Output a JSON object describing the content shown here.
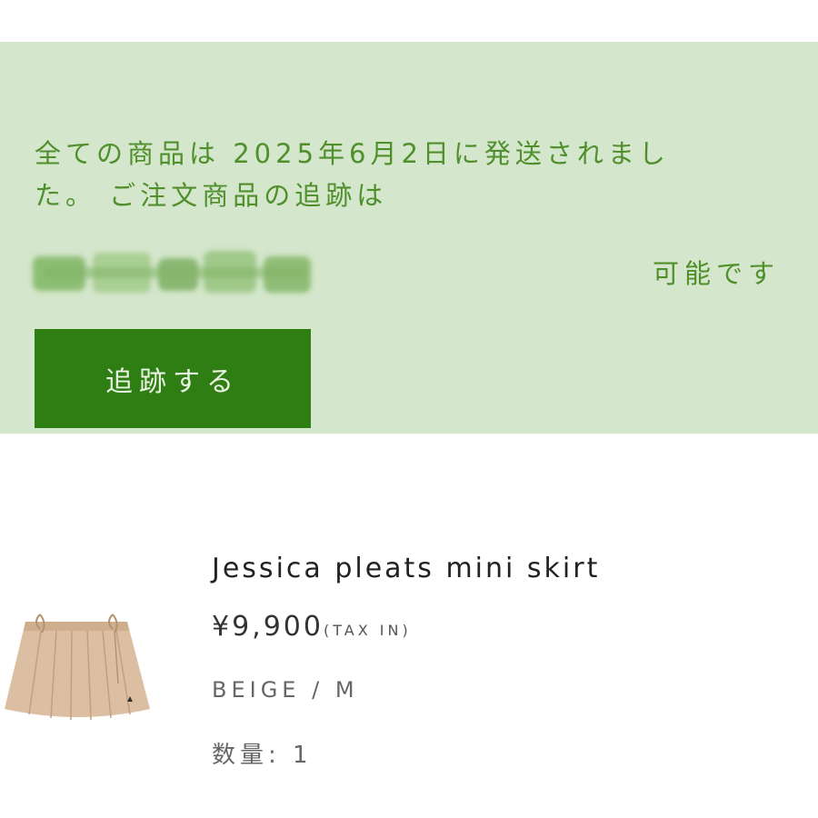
{
  "shipping_notice": {
    "line1": "全ての商品は 2025年6月2日に発送されまし",
    "line2": "た。 ご注文商品の追跡は",
    "available": "可能です",
    "track_button_label": "追跡する"
  },
  "order_item": {
    "name": "Jessica pleats mini skirt",
    "price": "¥9,900",
    "tax_note": "(TAX IN)",
    "variant": "BEIGE / M",
    "quantity_label": "数量:",
    "quantity": "1",
    "image_icon": "pleated-skirt-image"
  },
  "colors": {
    "notice_background": "#d4e6cb",
    "notice_text": "#4f8f2c",
    "button_background": "#2e7e13",
    "button_text": "#e9f3e2",
    "skirt": "#dcbfa3"
  }
}
